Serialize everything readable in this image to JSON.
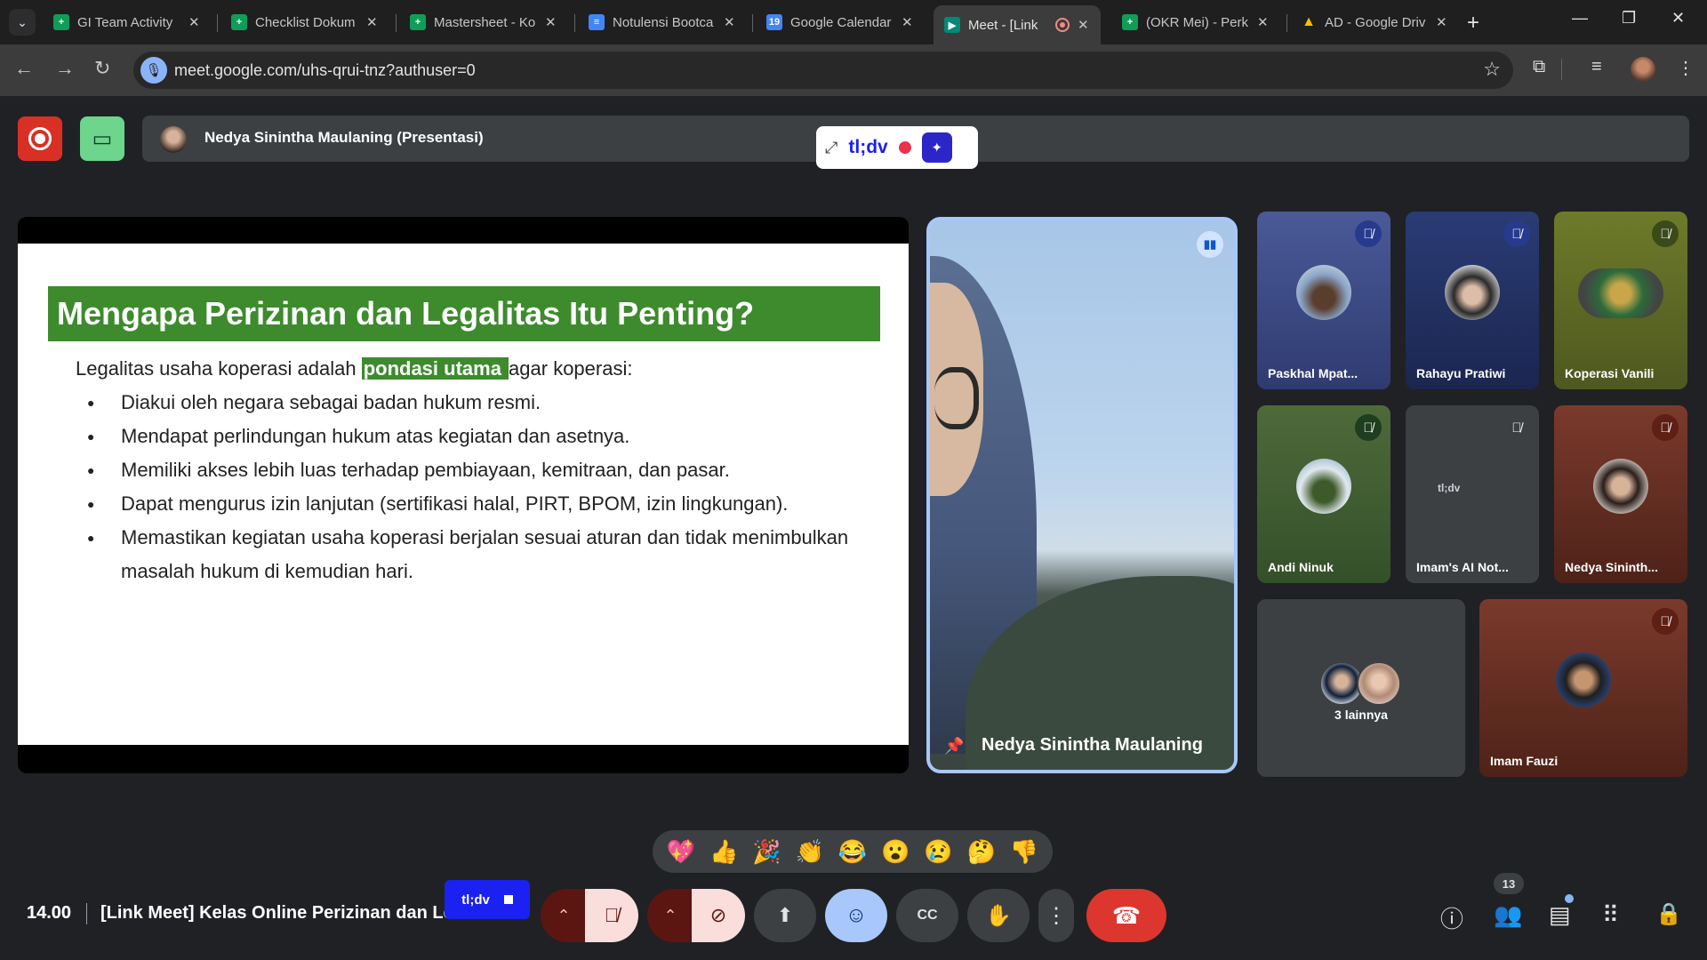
{
  "browser": {
    "tabs": [
      {
        "title": "GI Team Activity",
        "icon": "sheets-icon",
        "color": "#0f9d58"
      },
      {
        "title": "Checklist Dokum",
        "icon": "sheets-icon",
        "color": "#0f9d58"
      },
      {
        "title": "Mastersheet - Ko",
        "icon": "sheets-icon",
        "color": "#0f9d58"
      },
      {
        "title": "Notulensi Bootca",
        "icon": "docs-icon",
        "color": "#4285f4"
      },
      {
        "title": "Google Calendar",
        "icon": "calendar-icon",
        "color": "#4285f4",
        "icon_text": "19"
      },
      {
        "title": "Meet - [Link",
        "icon": "meet-icon",
        "color": "#00897b",
        "active": true
      },
      {
        "title": "(OKR Mei) - Perk",
        "icon": "sheets-icon",
        "color": "#0f9d58"
      },
      {
        "title": "AD - Google Driv",
        "icon": "drive-icon",
        "color": "#fbbc04"
      }
    ],
    "url": "meet.google.com/uhs-qrui-tnz?authuser=0"
  },
  "meet": {
    "presenter_label": "Nedya Sinintha Maulaning (Presentasi)",
    "tldv_label": "tl;dv",
    "slide": {
      "title": "Mengapa Perizinan dan Legalitas Itu Penting?",
      "lead_before": "Legalitas usaha koperasi adalah ",
      "lead_highlight": "pondasi utama ",
      "lead_after": "agar koperasi:",
      "bullets": [
        "Diakui oleh negara sebagai badan hukum resmi.",
        "Mendapat perlindungan hukum atas kegiatan dan asetnya.",
        "Memiliki akses lebih luas terhadap pembiayaan, kemitraan, dan pasar.",
        "Dapat mengurus izin lanjutan (sertifikasi halal, PIRT, BPOM, izin lingkungan).",
        "Memastikan kegiatan usaha koperasi berjalan sesuai aturan dan tidak menimbulkan masalah hukum di kemudian hari."
      ]
    },
    "pinned_name": "Nedya Sinintha Maulaning",
    "participants": [
      {
        "name": "Paskhal Mpat...",
        "mute_color": "#283a8e"
      },
      {
        "name": "Rahayu Pratiwi",
        "mute_color": "#283a8e"
      },
      {
        "name": "Koperasi Vanili",
        "mute_color": "#3a4a1a"
      },
      {
        "name": "Andi Ninuk",
        "mute_color": "#1f3d1f"
      },
      {
        "name": "Imam's AI Not...",
        "mute_color": "#3c4043"
      },
      {
        "name": "Nedya Sininth...",
        "mute_color": "#5e1f14"
      },
      {
        "name": "3 lainnya"
      },
      {
        "name": "Imam Fauzi",
        "mute_color": "#5e1f14"
      }
    ],
    "tldv_tile_caption": "tl;dv",
    "reactions": [
      "💖",
      "👍",
      "🎉",
      "👏",
      "😂",
      "😮",
      "😢",
      "🤔",
      "👎"
    ],
    "time": "14.00",
    "meeting_title": "[Link Meet] Kelas Online Perizinan dan Legalitas",
    "tldv_rec_label": "tl;dv",
    "people_count": "13"
  }
}
